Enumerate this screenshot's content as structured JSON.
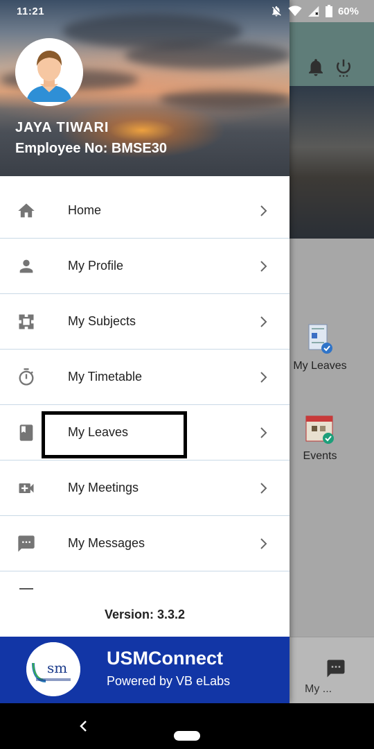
{
  "status_bar": {
    "time": "11:21",
    "battery": "60%"
  },
  "user": {
    "name": "JAYA  TIWARI",
    "employee": "Employee No: BMSE30"
  },
  "menu": {
    "items": [
      {
        "label": "Home",
        "icon": "home-icon"
      },
      {
        "label": "My Profile",
        "icon": "person-icon"
      },
      {
        "label": "My Subjects",
        "icon": "subjects-icon"
      },
      {
        "label": "My Timetable",
        "icon": "timer-icon"
      },
      {
        "label": "My Leaves",
        "icon": "book-icon"
      },
      {
        "label": "My Meetings",
        "icon": "video-call-icon"
      },
      {
        "label": "My Messages",
        "icon": "message-icon"
      }
    ]
  },
  "version": "Version: 3.3.2",
  "footer": {
    "title": "USMConnect",
    "subtitle": "Powered by VB eLabs",
    "logo_text": "usm"
  },
  "background_app": {
    "tiles": [
      "My Leaves",
      "Events"
    ],
    "bottom_tab": "My ..."
  },
  "colors": {
    "footer": "#1236a6",
    "divider": "#c9d9e6",
    "icon": "#757575"
  }
}
